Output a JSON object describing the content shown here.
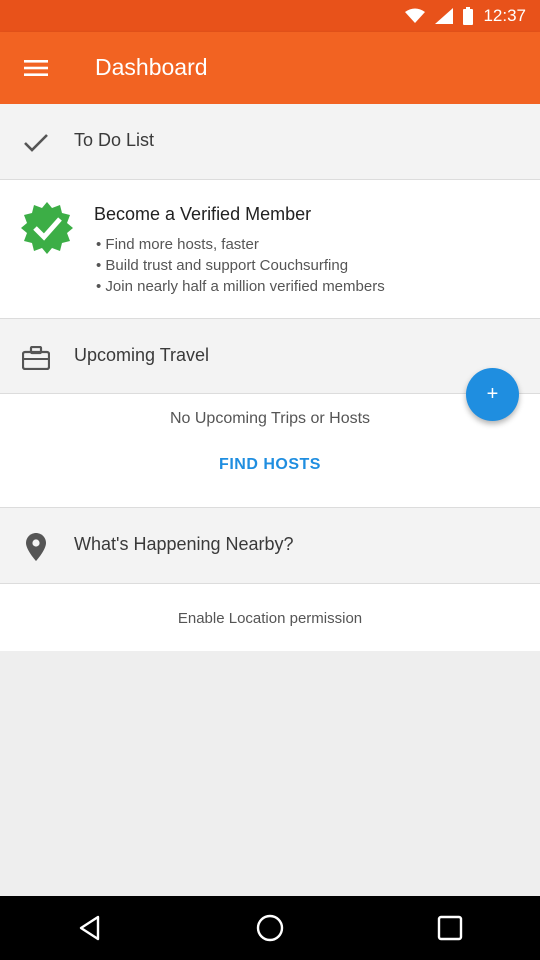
{
  "status_bar": {
    "time": "12:37"
  },
  "app_bar": {
    "title": "Dashboard"
  },
  "todo": {
    "label": "To Do List"
  },
  "verified": {
    "title": "Become a Verified Member",
    "bullets": [
      "Find more hosts, faster",
      "Build trust and support Couchsurfing",
      "Join nearly half a million verified members"
    ]
  },
  "upcoming": {
    "label": "Upcoming Travel",
    "fab_label": "+",
    "empty_text": "No Upcoming Trips or Hosts",
    "find_hosts": "FIND HOSTS"
  },
  "nearby": {
    "label": "What's Happening Nearby?",
    "permission_text": "Enable Location permission"
  },
  "colors": {
    "app_bar": "#f26322",
    "status_bar": "#e8521a",
    "accent": "#1f8ee0",
    "verified_badge": "#3cae46"
  }
}
